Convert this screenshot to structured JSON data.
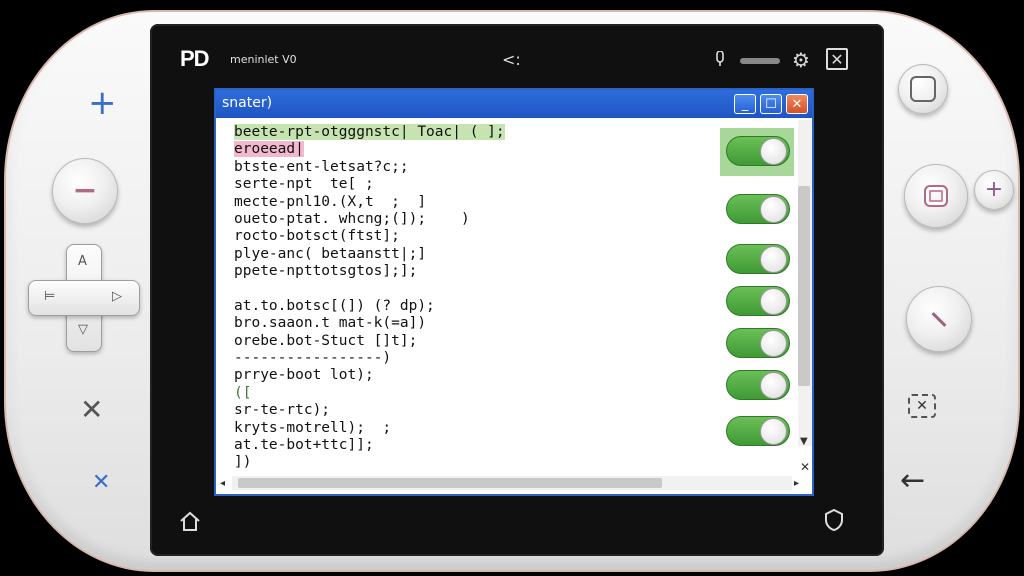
{
  "status_bar": {
    "logo": "PD",
    "app_name": "meninlet V0",
    "center_icon": "<:",
    "mic_icon": "microphone-icon",
    "gear_icon": "gear-icon",
    "close_icon": "close-icon"
  },
  "window": {
    "title": "snater)",
    "minimize_label": "_",
    "maximize_label": "☐",
    "close_label": "✕",
    "code_lines": [
      "beete-rpt-otgggnstc| Toac| ( ];",
      "eroeead|",
      "btste-ent-letsat?c;;",
      "serte-npt  te[ ;",
      "mecte-pnl10.(X,t  ;  ]",
      "oueto-ptat. whcng;(]);    )",
      "rocto-botsct(ftst];",
      "plye-anc( betaanstt|;]",
      "ppete-npttotsgtos];];",
      "",
      "at.to.botsc[(]) (? dp);",
      "bro.saaon.t mat-k(=a])",
      "orebe.bot-Stuct []t];",
      "-----------------)",
      "prrye-boot lot);",
      "([",
      "sr-te-rtc);",
      "kryts-motrell);  ;",
      "at.te-bot+ttc]];",
      "])"
    ],
    "toggles": [
      true,
      true,
      true,
      true,
      true,
      true,
      true
    ]
  },
  "colors": {
    "accent_blue": "#2c62c6",
    "toggle_green": "#4caf3f",
    "code_highlight_green": "#c6e4b0",
    "code_highlight_pink": "#f2b8d0",
    "shell_trim": "#d8b7ad"
  },
  "controls": {
    "left_plus": "+",
    "left_minus": "−",
    "left_x": "✕",
    "left_small_x": "✕",
    "dpad_up": "A",
    "dpad_down": "▽",
    "dpad_left": "⊨",
    "dpad_right": "▷",
    "right_square_icon": "square-button-icon",
    "right_plus": "+",
    "right_back": "←"
  },
  "bottom": {
    "home_icon": "home-icon",
    "shield_icon": "shield-icon"
  }
}
